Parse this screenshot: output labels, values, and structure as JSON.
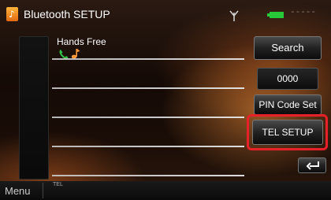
{
  "title_bar": {
    "app_icon_glyph": "♪",
    "title": "Bluetooth SETUP",
    "signal_text": "-----",
    "battery_color": "#27c93a"
  },
  "device_list": {
    "items": [
      {
        "name": "Hands Free",
        "icons": [
          "phone-icon",
          "music-icon"
        ]
      }
    ],
    "empty_row_count": 4
  },
  "buttons": {
    "search": "Search",
    "pin_code_value": "0000",
    "pin_code_set": "PIN Code Set",
    "tel_setup": "TEL SETUP",
    "back_icon": "return-arrow-icon"
  },
  "bottom_bar": {
    "menu": "Menu",
    "indicator": "TEL"
  },
  "colors": {
    "highlight": "#e8202a",
    "accent": "#ff9a3a"
  }
}
